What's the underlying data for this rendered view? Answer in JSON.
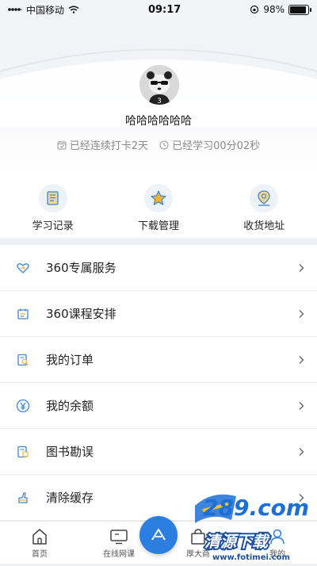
{
  "status_bar": {
    "carrier": "中国移动",
    "time": "09:17",
    "battery": "98%",
    "battery_level": 0.98
  },
  "profile": {
    "username": "哈哈哈哈哈哈",
    "checkin_text": "已经连续打卡2天",
    "study_time_text": "已经学习00分02秒"
  },
  "shortcuts": [
    {
      "label": "学习记录",
      "icon": "study-record-icon"
    },
    {
      "label": "下载管理",
      "icon": "download-manage-icon"
    },
    {
      "label": "收货地址",
      "icon": "address-icon"
    }
  ],
  "menu": [
    {
      "label": "360专属服务",
      "icon": "heart-service-icon"
    },
    {
      "label": "360课程安排",
      "icon": "calendar-icon"
    },
    {
      "label": "我的订单",
      "icon": "order-icon"
    },
    {
      "label": "我的余额",
      "icon": "yen-icon"
    },
    {
      "label": "图书勘误",
      "icon": "book-icon"
    },
    {
      "label": "清除缓存",
      "icon": "broom-icon"
    }
  ],
  "tabbar": {
    "items": [
      {
        "label": "首页",
        "icon": "home-icon"
      },
      {
        "label": "在线网课",
        "icon": "monitor-icon"
      },
      {
        "label": "厚大商",
        "icon": "shop-icon"
      },
      {
        "label": "我的",
        "icon": "user-icon"
      }
    ]
  },
  "watermark": {
    "line1": "289.com",
    "line2": "清源下载",
    "line3": "www.fotimei.com"
  },
  "colors": {
    "accent": "#2c7fe0",
    "icon_blue": "#3b86d6",
    "icon_orange": "#f2b233",
    "text_gray": "#8a8a8a"
  }
}
